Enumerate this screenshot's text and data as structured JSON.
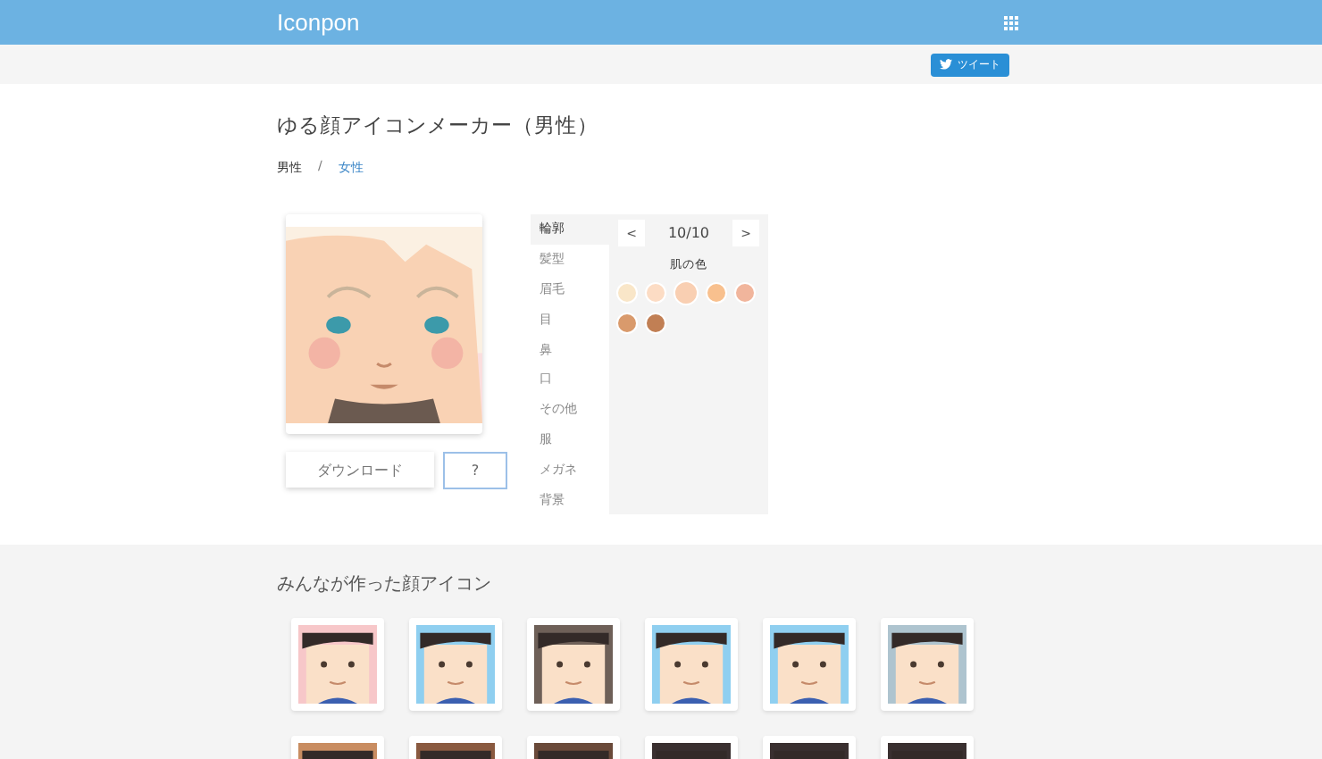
{
  "header": {
    "brand": "Iconpon"
  },
  "share": {
    "tweet_label": "ツイート"
  },
  "page": {
    "title": "ゆる顔アイコンメーカー（男性）",
    "separator": "/",
    "breadcrumbs": [
      {
        "label": "男性",
        "selected": true
      },
      {
        "label": "女性",
        "selected": false
      }
    ]
  },
  "editor": {
    "download_label": "ダウンロード",
    "help_label": "?",
    "parts": [
      {
        "label": "輪郭",
        "selected": true
      },
      {
        "label": "髪型",
        "selected": false
      },
      {
        "label": "眉毛",
        "selected": false
      },
      {
        "label": "目",
        "selected": false
      },
      {
        "label": "鼻",
        "selected": false
      },
      {
        "label": "口",
        "selected": false
      },
      {
        "label": "その他",
        "selected": false
      },
      {
        "label": "服",
        "selected": false
      },
      {
        "label": "メガネ",
        "selected": false
      },
      {
        "label": "背景",
        "selected": false
      }
    ],
    "prev_label": "<",
    "next_label": ">",
    "counter": "10/10",
    "swatch_title": "肌の色",
    "swatches": [
      {
        "color": "#f9e6c8",
        "selected": false
      },
      {
        "color": "#fcdcc4",
        "selected": false
      },
      {
        "color": "#f9cfb2",
        "selected": true
      },
      {
        "color": "#f8c08e",
        "selected": false
      },
      {
        "color": "#f1b59c",
        "selected": false
      },
      {
        "color": "#d99a6c",
        "selected": false
      },
      {
        "color": "#c17f54",
        "selected": false
      }
    ]
  },
  "gallery": {
    "title": "みんなが作った顔アイコン",
    "icons": [
      {
        "color": "#f7c7c9"
      },
      {
        "color": "#8fcff0"
      },
      {
        "color": "#6e6058"
      },
      {
        "color": "#8fcff0"
      },
      {
        "color": "#8fcff0"
      },
      {
        "color": "#aec4cf"
      },
      {
        "color": "#c98d61"
      },
      {
        "color": "#8a5a40"
      },
      {
        "color": "#6a4a3a"
      },
      {
        "color": "#3a3030"
      },
      {
        "color": "#3a3030"
      },
      {
        "color": "#3a3030"
      }
    ]
  }
}
